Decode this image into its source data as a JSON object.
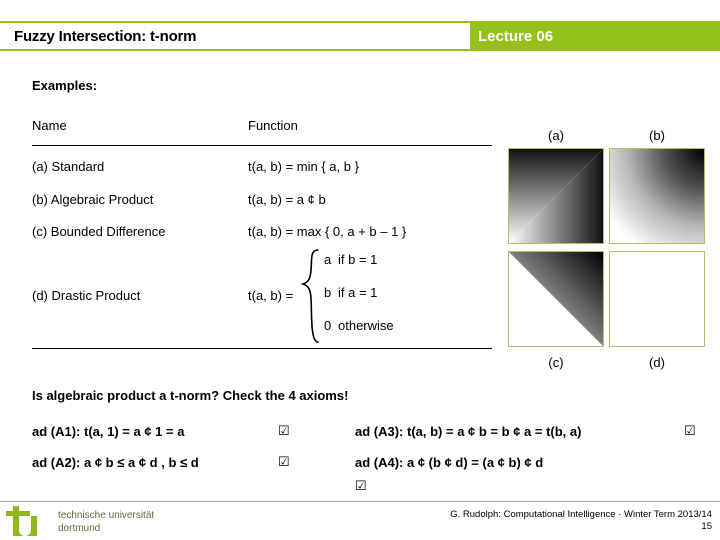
{
  "header": {
    "title": "Fuzzy Intersection: t-norm",
    "lecture": "Lecture 06",
    "accent_color": "#94c11c"
  },
  "body": {
    "examples_heading": "Examples:",
    "table": {
      "columns": [
        "Name",
        "Function"
      ],
      "rows": [
        {
          "name": "(a) Standard",
          "function": "t(a, b) = min { a, b }"
        },
        {
          "name": "(b) Algebraic Product",
          "function": "t(a, b) = a ¢ b"
        },
        {
          "name": "(c) Bounded Difference",
          "function": "t(a, b) = max { 0, a + b – 1 }"
        },
        {
          "name": "(d) Drastic Product",
          "function": "t(a, b) ="
        }
      ],
      "drastic_cases": [
        {
          "value": "a",
          "condition": "if b = 1"
        },
        {
          "value": "b",
          "condition": "if a = 1"
        },
        {
          "value": "0",
          "condition": "otherwise"
        }
      ]
    },
    "plots": [
      {
        "id": "a",
        "label": "(a)",
        "kind": "min",
        "border_color": "#a9c26a"
      },
      {
        "id": "b",
        "label": "(b)",
        "kind": "product",
        "border_color": "#a9c26a"
      },
      {
        "id": "c",
        "label": "(c)",
        "kind": "bounded-difference",
        "border_color": "#a9c26a"
      },
      {
        "id": "d",
        "label": "(d)",
        "kind": "drastic",
        "border_color": "#a9c26a"
      }
    ],
    "question": "Is algebraic product a t-norm?  Check the 4 axioms!",
    "axioms": [
      {
        "id": "A1",
        "text": "ad (A1): t(a, 1) = a ¢ 1 = a",
        "checked": "☑"
      },
      {
        "id": "A2",
        "text": "ad (A2): a ¢ b ≤ a ¢ d , b ≤ d",
        "checked": "☑"
      },
      {
        "id": "A3",
        "text": "ad (A3): t(a, b) = a ¢ b = b ¢ a = t(b, a)",
        "checked": "☑"
      },
      {
        "id": "A4",
        "text": "ad (A4): a ¢ (b ¢ d) = (a ¢ b) ¢ d",
        "checked": "☑"
      }
    ]
  },
  "footer": {
    "logo_line1": "technische universität",
    "logo_line2": "dortmund",
    "credit": "G. Rudolph: Computational Intelligence · Winter Term 2013/14",
    "page": "15"
  }
}
